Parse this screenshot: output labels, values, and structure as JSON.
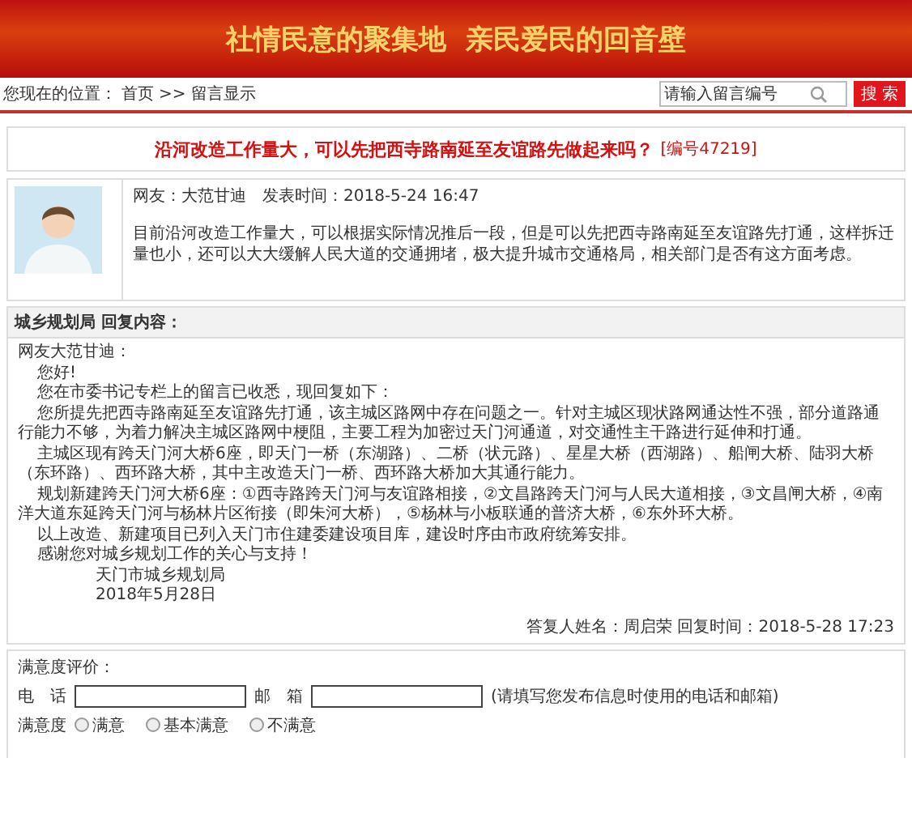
{
  "banner": {
    "slogan": "社情民意的聚集地  亲民爱民的回音壁"
  },
  "breadcrumb": {
    "label": "您现在的位置：",
    "items": [
      {
        "text": "首页"
      },
      {
        "text": "留言显示"
      }
    ],
    "separator": ">>"
  },
  "search": {
    "value": "请输入留言编号",
    "button": "搜 索"
  },
  "message": {
    "title": "沿河改造工作量大，可以先把西寺路南延至友谊路先做起来吗？",
    "number": "[编号47219]",
    "author": "网友：大范甘迪",
    "time": "发表时间：2018-5-24 16:47",
    "body": "目前沿河改造工作量大，可以根据实际情况推后一段，但是可以先把西寺路南延至友谊路先打通，这样拆迁量也小，还可以大大缓解人民大道的交通拥堵，极大提升城市交通格局，相关部门是否有这方面考虑。"
  },
  "reply": {
    "heading": "城乡规划局 回复内容：",
    "paragraphs": [
      {
        "kind": "plain",
        "text": "网友大范甘迪："
      },
      {
        "kind": "indent",
        "text": "您好!"
      },
      {
        "kind": "indent",
        "text": "您在市委书记专栏上的留言已收悉，现回复如下："
      },
      {
        "kind": "indent",
        "text": "您所提先把西寺路南延至友谊路先打通，该主城区路网中存在问题之一。针对主城区现状路网通达性不强，部分道路通行能力不够，为着力解决主城区路网中梗阻，主要工程为加密过天门河通道，对交通性主干路进行延伸和打通。"
      },
      {
        "kind": "indent",
        "text": "主城区现有跨天门河大桥6座，即天门一桥（东湖路）、二桥（状元路）、星星大桥（西湖路）、船闸大桥、陆羽大桥（东环路）、西环路大桥，其中主改造天门一桥、西环路大桥加大其通行能力。"
      },
      {
        "kind": "indent",
        "text": "规划新建跨天门河大桥6座：①西寺路跨天门河与友谊路相接，②文昌路跨天门河与人民大道相接，③文昌闸大桥，④南洋大道东延跨天门河与杨林片区衔接（即朱河大桥），⑤杨林与小板联通的普济大桥，⑥东外环大桥。"
      },
      {
        "kind": "indent",
        "text": "以上改造、新建项目已列入天门市住建委建设项目库，建设时序由市政府统筹安排。"
      },
      {
        "kind": "indent",
        "text": "感谢您对城乡规划工作的关心与支持！"
      },
      {
        "kind": "sign",
        "text": "天门市城乡规划局"
      },
      {
        "kind": "sign",
        "text": "2018年5月28日"
      }
    ],
    "footer": "答复人姓名：周启荣 回复时间：2018-5-28 17:23"
  },
  "rating": {
    "heading": "满意度评价：",
    "phone_label": "电　话",
    "email_label": "邮　箱",
    "hint": "(请填写您发布信息时使用的电话和邮箱)",
    "choice_label": "满意度",
    "options": [
      {
        "label": "满意",
        "selected": false
      },
      {
        "label": "基本满意",
        "selected": false
      },
      {
        "label": "不满意",
        "selected": false
      }
    ]
  }
}
